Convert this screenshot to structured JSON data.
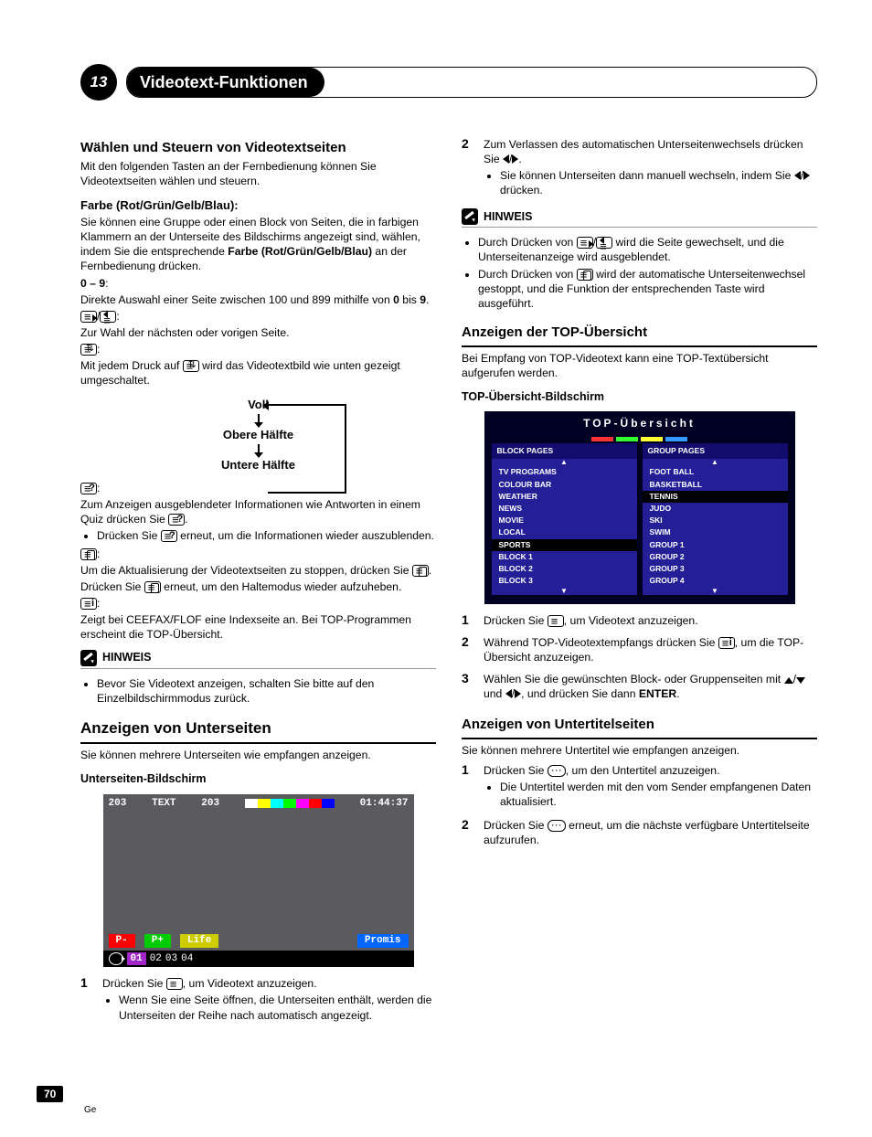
{
  "chapter": {
    "number": "13",
    "title": "Videotext-Funktionen"
  },
  "page": {
    "number": "70",
    "lang": "Ge"
  },
  "left": {
    "h_select": "Wählen und Steuern von Videotextseiten",
    "select_intro": "Mit den folgenden Tasten an der Fernbedienung können Sie Videotextseiten wählen und steuern.",
    "h_color": "Farbe (Rot/Grün/Gelb/Blau):",
    "color_p1": "Sie können eine Gruppe oder einen Block von Seiten, die in farbigen Klammern an der Unterseite des Bildschirms angezeigt sind, wählen, indem Sie die entsprechende ",
    "color_b1": "Farbe (Rot/Grün/Gelb/Blau)",
    "color_p2": " an der Fernbedienung drücken.",
    "digits_label": "0 – 9",
    "digits_p": "Direkte Auswahl einer Seite zwischen 100 und 899 mithilfe von ",
    "digits_b": "0",
    "digits_mid": " bis ",
    "digits_b2": "9",
    "nextprev": "Zur Wahl der nächsten oder vorigen Seite.",
    "toggle": "Mit jedem Druck auf        wird das Videotextbild wie unten gezeigt umgeschaltet.",
    "cycle": {
      "full": "Voll",
      "upper": "Obere Hälfte",
      "lower": "Untere Hälfte"
    },
    "reveal_p": "Zum Anzeigen ausgeblendeter Informationen wie Antworten in einem Quiz drücken Sie",
    "reveal_b": "Drücken Sie        erneut, um die Informationen wieder auszublenden.",
    "hold_p": "Um die Aktualisierung der Videotextseiten zu stoppen, drücken Sie",
    "hold_b": "Drücken Sie        erneut, um den Haltemodus wieder aufzuheben.",
    "index_p": "Zeigt bei CEEFAX/FLOF eine Indexseite an. Bei TOP-Programmen erscheint die TOP-Übersicht.",
    "hinweis": "HINWEIS",
    "hinweis_body": "Bevor Sie Videotext anzeigen, schalten Sie bitte auf den Einzelbildschirmmodus zurück.",
    "h_sub": "Anzeigen von Unterseiten",
    "sub_intro": "Sie können mehrere Unterseiten wie empfangen anzeigen.",
    "sub_screen_label": "Unterseiten-Bildschirm",
    "screen": {
      "page": "203",
      "text": "TEXT",
      "page2": "203",
      "time": "01:44:37",
      "p_minus": "P-",
      "p_plus": "P+",
      "life": "Life",
      "promis": "Promis",
      "subs": [
        "01",
        "02",
        "03",
        "04"
      ]
    },
    "step1": "Drücken Sie       , um Videotext anzuzeigen.",
    "step1_b": "Wenn Sie eine Seite öffnen, die Unterseiten enthält, werden die Unterseiten der Reihe nach automatisch angezeigt."
  },
  "right": {
    "step2": "Zum Verlassen des automatischen Unterseitenwechsels drücken Sie     /    .",
    "step2_b": "Sie können Unterseiten dann manuell wechseln, indem Sie     /     drücken.",
    "hinweis_a": "Durch Drücken von        /        wird die Seite gewechselt, und die Unterseitenanzeige wird ausgeblendet.",
    "hinweis_b": "Durch Drücken von        wird der automatische Unterseitenwechsel gestoppt, und die Funktion der entsprechenden Taste wird ausgeführt.",
    "h_top": "Anzeigen der TOP-Übersicht",
    "top_intro": "Bei Empfang von TOP-Videotext kann eine TOP-Textübersicht aufgerufen werden.",
    "top_label": "TOP-Übersicht-Bildschirm",
    "top": {
      "title": "TOP-Übersicht",
      "left_h": "BLOCK PAGES",
      "left": [
        "TV PROGRAMS",
        "COLOUR BAR",
        "WEATHER",
        "NEWS",
        "MOVIE",
        "LOCAL",
        "SPORTS",
        "BLOCK 1",
        "BLOCK 2",
        "BLOCK 3"
      ],
      "left_hl": "SPORTS",
      "right_h": "GROUP PAGES",
      "right": [
        "FOOT BALL",
        "BASKETBALL",
        "TENNIS",
        "JUDO",
        "SKI",
        "SWIM",
        "GROUP 1",
        "GROUP 2",
        "GROUP 3",
        "GROUP 4"
      ],
      "right_hl": "TENNIS"
    },
    "top_step1": "Drücken Sie       , um Videotext anzuzeigen.",
    "top_step2": "Während TOP-Videotextempfangs drücken Sie       , um die TOP-Übersicht anzuzeigen.",
    "top_step3_a": "Wählen Sie die gewünschten Block- oder Gruppenseiten mit ",
    "top_step3_b": " und ",
    "top_step3_c": ", und drücken Sie dann ",
    "enter": "ENTER",
    "h_subt": "Anzeigen von Untertitelseiten",
    "subt_intro": "Sie können mehrere Untertitel wie empfangen anzeigen.",
    "subt_step1": "Drücken Sie        , um den Untertitel anzuzeigen.",
    "subt_step1_b": "Die Untertitel werden mit den vom Sender empfangenen Daten aktualisiert.",
    "subt_step2": "Drücken Sie        erneut, um die nächste verfügbare Untertitelseite aufzurufen."
  }
}
